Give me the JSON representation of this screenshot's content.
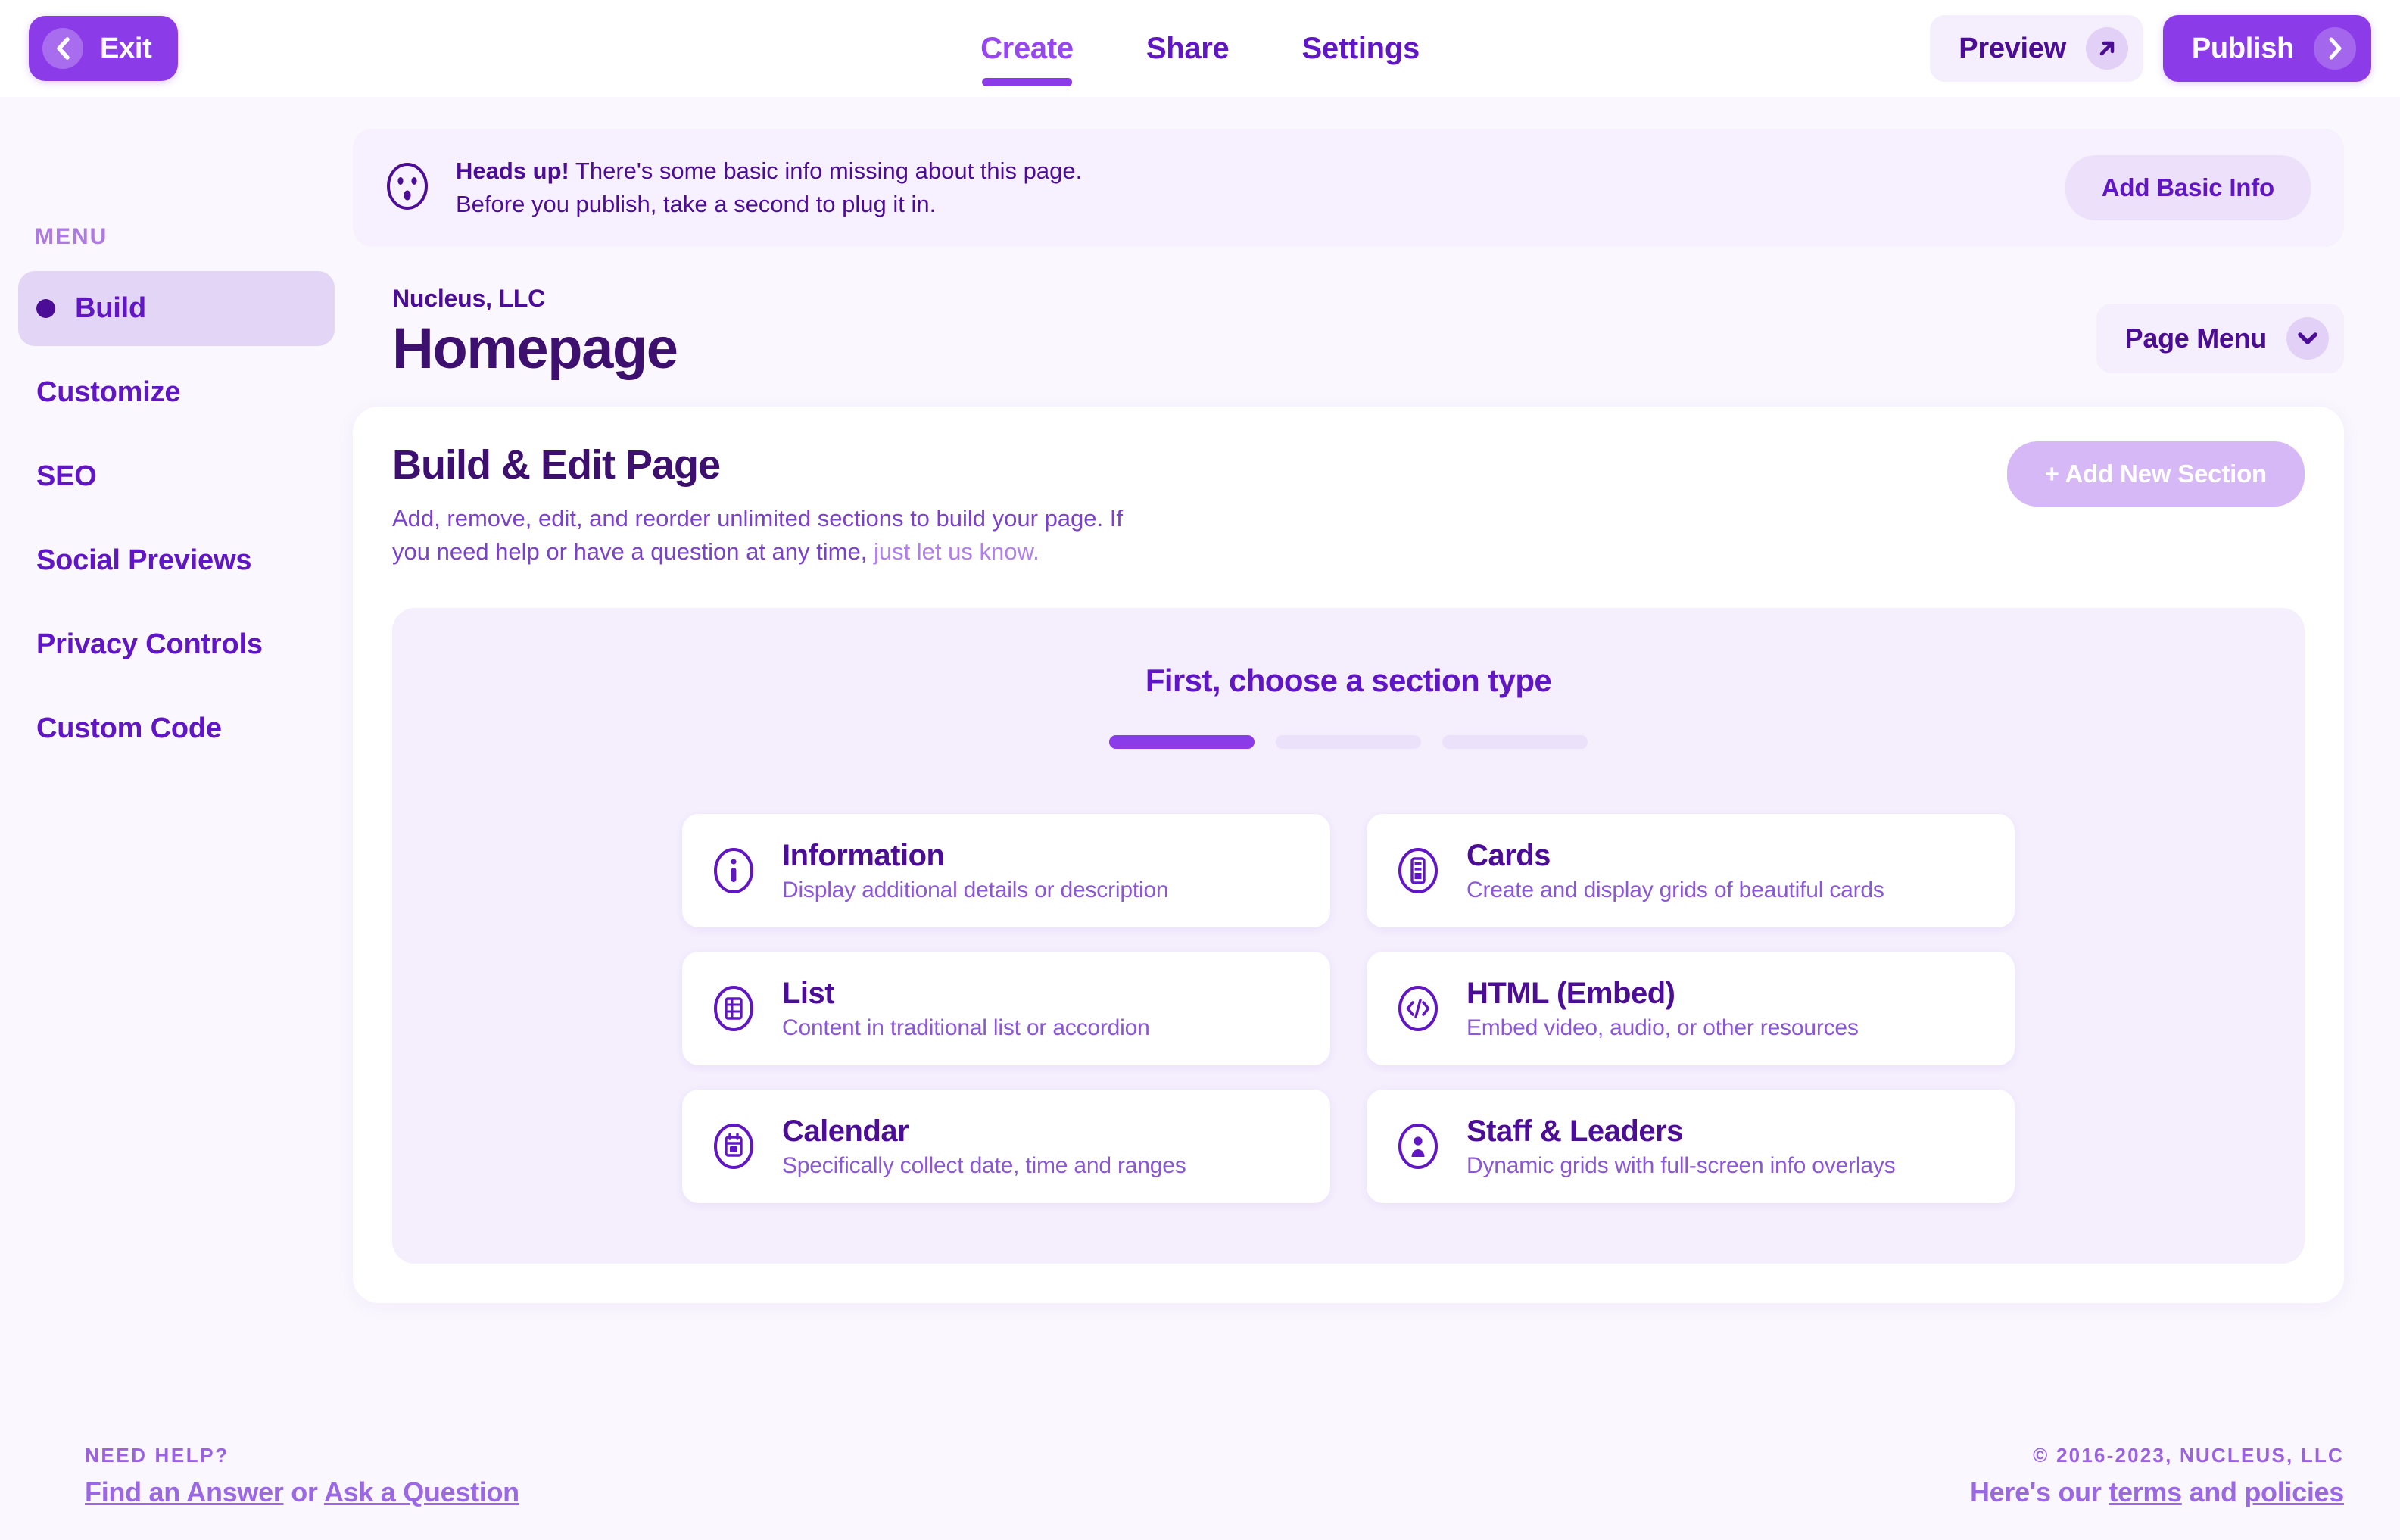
{
  "topbar": {
    "exit_label": "Exit",
    "exit_icon": "chevron-left-icon",
    "tabs": [
      {
        "label": "Create",
        "active": true
      },
      {
        "label": "Share",
        "active": false
      },
      {
        "label": "Settings",
        "active": false
      }
    ],
    "preview_label": "Preview",
    "preview_icon": "arrow-up-right-icon",
    "publish_label": "Publish",
    "publish_icon": "chevron-right-icon"
  },
  "sidebar": {
    "heading": "MENU",
    "items": [
      {
        "label": "Build",
        "active": true
      },
      {
        "label": "Customize",
        "active": false
      },
      {
        "label": "SEO",
        "active": false
      },
      {
        "label": "Social Previews",
        "active": false
      },
      {
        "label": "Privacy Controls",
        "active": false
      },
      {
        "label": "Custom Code",
        "active": false
      }
    ]
  },
  "banner": {
    "icon": "surprised-face-icon",
    "bold": "Heads up!",
    "line1": " There's some basic info missing about this page.",
    "line2": "Before you publish, take a second to plug it in.",
    "button_label": "Add Basic Info"
  },
  "page_header": {
    "org": "Nucleus, LLC",
    "title": "Homepage",
    "menu_label": "Page Menu",
    "menu_icon": "chevron-down-icon"
  },
  "panel": {
    "title": "Build & Edit Page",
    "description_1": "Add, remove, edit, and reorder unlimited sections to build your page. If you need help or have a question at any time, ",
    "description_link": "just let us know.",
    "add_section_label": "+ Add New Section"
  },
  "chooser": {
    "title": "First, choose a section type",
    "steps": [
      {
        "done": true
      },
      {
        "done": false
      },
      {
        "done": false
      }
    ],
    "section_types": [
      {
        "icon": "info-circle-icon",
        "name": "Information",
        "desc": "Display additional details or description"
      },
      {
        "icon": "cards-icon",
        "name": "Cards",
        "desc": "Create and display grids of beautiful cards"
      },
      {
        "icon": "list-icon",
        "name": "List",
        "desc": "Content in traditional list or accordion"
      },
      {
        "icon": "code-icon",
        "name": "HTML (Embed)",
        "desc": "Embed video, audio, or other resources"
      },
      {
        "icon": "calendar-icon",
        "name": "Calendar",
        "desc": "Specifically collect date, time and ranges"
      },
      {
        "icon": "person-icon",
        "name": "Staff & Leaders",
        "desc": "Dynamic grids with full-screen info overlays"
      }
    ]
  },
  "footer": {
    "need_help": "NEED HELP?",
    "find_answer": "Find an Answer",
    "or": " or ",
    "ask_question": "Ask a Question",
    "copyright": "© 2016-2023, NUCLEUS, LLC",
    "legal_prefix": "Here's our ",
    "terms": "terms",
    "legal_mid": " and ",
    "policies": "policies"
  },
  "colors": {
    "accent": "#8b3ce8",
    "deep_purple": "#4c0d96",
    "title_purple": "#3d1070",
    "page_bg": "#faf7fe",
    "panel_bg": "#f4eefd",
    "banner_bg": "#f7f0fe"
  }
}
